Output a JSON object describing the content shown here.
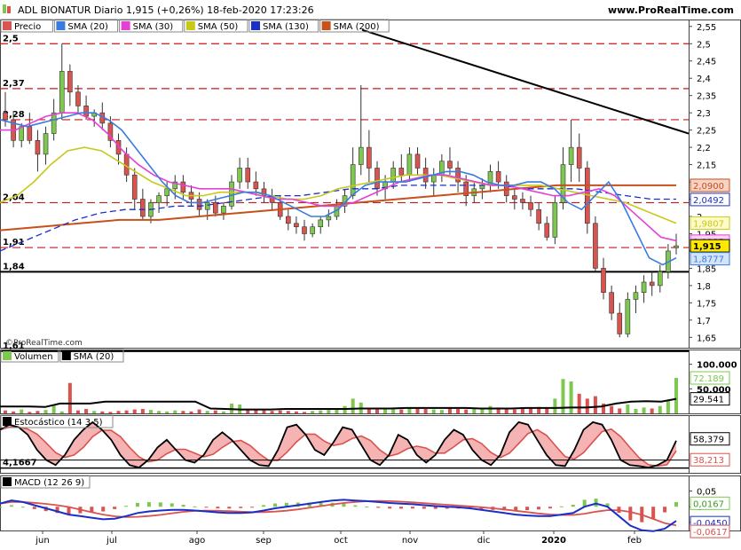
{
  "header": {
    "title": "ADL BIONATUR Diario 1,915 (+0,26%) 18-feb-2020 17:23:26",
    "website": "www.ProRealTime.com",
    "watermark": "©ProRealTime.com"
  },
  "colors": {
    "up": "#7ec850",
    "down": "#d9534f",
    "sma20": "#3a7be0",
    "sma30": "#e63fd8",
    "sma50": "#c8c81a",
    "sma130": "#1a2fc8",
    "sma200": "#c8501a",
    "support": "#c81a1a",
    "fill_up": "#f2a0a0",
    "fill_down": "#9a9aa8"
  },
  "chart_data": [
    {
      "type": "candlestick",
      "panel": "price",
      "legend": [
        {
          "label": "Precio",
          "color": "#d9534f"
        },
        {
          "label": "SMA (20)",
          "color": "#3a7be0"
        },
        {
          "label": "SMA (30)",
          "color": "#e63fd8"
        },
        {
          "label": "SMA (50)",
          "color": "#c8c81a"
        },
        {
          "label": "SMA (130)",
          "color": "#1a2fc8"
        },
        {
          "label": "SMA (200)",
          "color": "#c8501a"
        }
      ],
      "x_ticks": [
        "jun",
        "jul",
        "ago",
        "sep",
        "oct",
        "nov",
        "dic",
        "2020",
        "feb"
      ],
      "y_ticks": [
        "2,55",
        "2,5",
        "2,45",
        "2,4",
        "2,35",
        "2,3",
        "2,25",
        "2,2",
        "2,15",
        "2,1",
        "2,05",
        "2",
        "1,95",
        "1,9",
        "1,85",
        "1,8",
        "1,75",
        "1,7",
        "1,65"
      ],
      "ylim": [
        1.62,
        2.57
      ],
      "level_labels": [
        "2,5",
        "2,37",
        "2,28",
        "2,04",
        "1,91",
        "1,84",
        "1,61"
      ],
      "dashed_levels": [
        2.5,
        2.37,
        2.28,
        2.04,
        1.91
      ],
      "solid_levels": [
        1.84,
        1.61
      ],
      "trendline": {
        "from": [
          "oct",
          2.54
        ],
        "to": [
          "2020-feb end",
          2.24
        ]
      },
      "right_labels": [
        {
          "text": "2,0900",
          "value": 2.09,
          "bg": "#f6d3c4",
          "border": "#c8501a"
        },
        {
          "text": "2,0492",
          "value": 2.049,
          "bg": "#ffffff",
          "border": "#1a2fc8"
        },
        {
          "text": "1,9807",
          "value": 1.981,
          "bg": "#fdfcc8",
          "border": "#c8c81a"
        },
        {
          "text": "1,9185",
          "value": 1.9285,
          "bg": "#f8d3f4",
          "border": "#e63fd8"
        },
        {
          "text": "1,915",
          "value": 1.915,
          "bg": "#ffe800",
          "border": "#000000",
          "bold": true
        },
        {
          "text": "1,8777",
          "value": 1.8777,
          "bg": "#d3e3f8",
          "border": "#3a7be0"
        }
      ],
      "approx_series": {
        "close_open_ranges_note": "candles approximated from chart; last close 1.915",
        "candles": [
          [
            2.3,
            2.36,
            2.26,
            2.28
          ],
          [
            2.28,
            2.3,
            2.2,
            2.22
          ],
          [
            2.22,
            2.27,
            2.2,
            2.26
          ],
          [
            2.26,
            2.3,
            2.21,
            2.22
          ],
          [
            2.22,
            2.25,
            2.13,
            2.18
          ],
          [
            2.18,
            2.26,
            2.15,
            2.24
          ],
          [
            2.24,
            2.34,
            2.22,
            2.3
          ],
          [
            2.3,
            2.5,
            2.28,
            2.42
          ],
          [
            2.42,
            2.44,
            2.32,
            2.36
          ],
          [
            2.36,
            2.38,
            2.3,
            2.32
          ],
          [
            2.32,
            2.35,
            2.28,
            2.29
          ],
          [
            2.29,
            2.31,
            2.26,
            2.3
          ],
          [
            2.3,
            2.33,
            2.25,
            2.27
          ],
          [
            2.27,
            2.29,
            2.2,
            2.22
          ],
          [
            2.22,
            2.24,
            2.15,
            2.18
          ],
          [
            2.18,
            2.2,
            2.1,
            2.12
          ],
          [
            2.12,
            2.14,
            2.02,
            2.05
          ],
          [
            2.05,
            2.08,
            1.99,
            2.0
          ],
          [
            2.0,
            2.05,
            1.98,
            2.04
          ],
          [
            2.04,
            2.07,
            2.01,
            2.06
          ],
          [
            2.06,
            2.1,
            2.03,
            2.08
          ],
          [
            2.08,
            2.12,
            2.05,
            2.1
          ],
          [
            2.1,
            2.12,
            2.05,
            2.07
          ],
          [
            2.07,
            2.09,
            2.03,
            2.05
          ],
          [
            2.05,
            2.07,
            2.0,
            2.02
          ],
          [
            2.02,
            2.05,
            1.99,
            2.04
          ],
          [
            2.04,
            2.06,
            2.0,
            2.01
          ],
          [
            2.01,
            2.04,
            1.99,
            2.03
          ],
          [
            2.03,
            2.12,
            2.02,
            2.1
          ],
          [
            2.1,
            2.17,
            2.08,
            2.14
          ],
          [
            2.14,
            2.17,
            2.08,
            2.1
          ],
          [
            2.1,
            2.13,
            2.06,
            2.08
          ],
          [
            2.08,
            2.1,
            2.04,
            2.06
          ],
          [
            2.06,
            2.08,
            2.02,
            2.04
          ],
          [
            2.04,
            2.06,
            1.99,
            2.0
          ],
          [
            2.0,
            2.02,
            1.96,
            1.98
          ],
          [
            1.98,
            2.0,
            1.95,
            1.97
          ],
          [
            1.97,
            1.99,
            1.93,
            1.95
          ],
          [
            1.95,
            1.98,
            1.94,
            1.97
          ],
          [
            1.97,
            2.0,
            1.95,
            1.99
          ],
          [
            1.99,
            2.02,
            1.97,
            2.0
          ],
          [
            2.0,
            2.05,
            1.99,
            2.03
          ],
          [
            2.03,
            2.08,
            2.01,
            2.06
          ],
          [
            2.06,
            2.2,
            2.05,
            2.15
          ],
          [
            2.15,
            2.38,
            2.12,
            2.2
          ],
          [
            2.2,
            2.25,
            2.1,
            2.14
          ],
          [
            2.14,
            2.16,
            2.06,
            2.08
          ],
          [
            2.08,
            2.12,
            2.05,
            2.1
          ],
          [
            2.1,
            2.16,
            2.08,
            2.14
          ],
          [
            2.14,
            2.18,
            2.1,
            2.12
          ],
          [
            2.12,
            2.2,
            2.1,
            2.18
          ],
          [
            2.18,
            2.2,
            2.12,
            2.14
          ],
          [
            2.14,
            2.17,
            2.08,
            2.1
          ],
          [
            2.1,
            2.14,
            2.06,
            2.12
          ],
          [
            2.12,
            2.18,
            2.1,
            2.16
          ],
          [
            2.16,
            2.2,
            2.12,
            2.14
          ],
          [
            2.14,
            2.16,
            2.07,
            2.1
          ],
          [
            2.1,
            2.12,
            2.03,
            2.06
          ],
          [
            2.06,
            2.1,
            2.04,
            2.08
          ],
          [
            2.08,
            2.11,
            2.05,
            2.09
          ],
          [
            2.09,
            2.15,
            2.07,
            2.13
          ],
          [
            2.13,
            2.16,
            2.08,
            2.1
          ],
          [
            2.1,
            2.12,
            2.04,
            2.06
          ],
          [
            2.06,
            2.08,
            2.02,
            2.05
          ],
          [
            2.05,
            2.07,
            2.02,
            2.04
          ],
          [
            2.04,
            2.06,
            2.0,
            2.02
          ],
          [
            2.02,
            2.04,
            1.96,
            1.98
          ],
          [
            1.98,
            2.0,
            1.93,
            1.94
          ],
          [
            1.94,
            2.06,
            1.92,
            2.04
          ],
          [
            2.04,
            2.2,
            2.02,
            2.15
          ],
          [
            2.15,
            2.28,
            2.1,
            2.2
          ],
          [
            2.2,
            2.24,
            2.1,
            2.14
          ],
          [
            2.14,
            2.16,
            1.95,
            1.98
          ],
          [
            1.98,
            2.0,
            1.84,
            1.85
          ],
          [
            1.85,
            1.88,
            1.76,
            1.78
          ],
          [
            1.78,
            1.8,
            1.7,
            1.72
          ],
          [
            1.72,
            1.75,
            1.65,
            1.66
          ],
          [
            1.66,
            1.78,
            1.65,
            1.76
          ],
          [
            1.76,
            1.8,
            1.72,
            1.78
          ],
          [
            1.78,
            1.83,
            1.75,
            1.81
          ],
          [
            1.81,
            1.84,
            1.77,
            1.8
          ],
          [
            1.8,
            1.86,
            1.78,
            1.84
          ],
          [
            1.84,
            1.92,
            1.82,
            1.9
          ],
          [
            1.91,
            1.95,
            1.89,
            1.915
          ]
        ],
        "sma20": [
          2.28,
          2.27,
          2.26,
          2.27,
          2.28,
          2.29,
          2.3,
          2.3,
          2.28,
          2.25,
          2.2,
          2.15,
          2.1,
          2.06,
          2.04,
          2.04,
          2.05,
          2.06,
          2.07,
          2.07,
          2.06,
          2.04,
          2.02,
          2.0,
          2.0,
          2.02,
          2.06,
          2.09,
          2.1,
          2.1,
          2.1,
          2.11,
          2.12,
          2.13,
          2.13,
          2.12,
          2.1,
          2.09,
          2.09,
          2.1,
          2.1,
          2.08,
          2.04,
          2.02,
          2.06,
          2.1,
          2.04,
          1.96,
          1.88,
          1.86,
          1.88
        ],
        "sma30": [
          2.25,
          2.25,
          2.27,
          2.29,
          2.3,
          2.3,
          2.28,
          2.24,
          2.19,
          2.15,
          2.12,
          2.1,
          2.09,
          2.08,
          2.08,
          2.08,
          2.07,
          2.06,
          2.05,
          2.05,
          2.04,
          2.03,
          2.03,
          2.04,
          2.06,
          2.08,
          2.1,
          2.11,
          2.12,
          2.12,
          2.11,
          2.1,
          2.09,
          2.09,
          2.08,
          2.07,
          2.06,
          2.06,
          2.07,
          2.08,
          2.06,
          2.02,
          1.98,
          1.94,
          1.93
        ],
        "sma50": [
          2.04,
          2.06,
          2.1,
          2.15,
          2.19,
          2.2,
          2.19,
          2.16,
          2.13,
          2.1,
          2.08,
          2.06,
          2.06,
          2.07,
          2.07,
          2.07,
          2.06,
          2.05,
          2.05,
          2.06,
          2.08,
          2.09,
          2.1,
          2.11,
          2.12,
          2.12,
          2.12,
          2.11,
          2.1,
          2.09,
          2.09,
          2.09,
          2.09,
          2.08,
          2.07,
          2.06,
          2.05,
          2.04,
          2.02,
          2.0,
          1.98
        ],
        "sma130": [
          1.9,
          1.93,
          1.96,
          1.99,
          2.01,
          2.02,
          2.02,
          2.03,
          2.03,
          2.04,
          2.05,
          2.06,
          2.06,
          2.07,
          2.08,
          2.08,
          2.09,
          2.09,
          2.09,
          2.09,
          2.09,
          2.08,
          2.08,
          2.08,
          2.07,
          2.06,
          2.05,
          2.05
        ],
        "sma200": [
          1.96,
          1.97,
          1.98,
          1.99,
          1.99,
          2.0,
          2.01,
          2.02,
          2.03,
          2.04,
          2.05,
          2.06,
          2.07,
          2.08,
          2.09,
          2.09,
          2.09,
          2.09
        ]
      }
    },
    {
      "type": "bar",
      "panel": "volume",
      "legend": [
        {
          "label": "Volumen",
          "color": "#7ec850"
        },
        {
          "label": "SMA (20)",
          "color": "#000000"
        }
      ],
      "y_ticks": [
        "100.000",
        "50.000"
      ],
      "right_labels": [
        {
          "text": "72.189",
          "bg": "#ffffff",
          "border": "#7ec850",
          "color": "#7ec850"
        },
        {
          "text": "29.541",
          "bg": "#ffffff",
          "border": "#000000",
          "color": "#000000"
        }
      ]
    },
    {
      "type": "line",
      "panel": "stochastic",
      "legend": [
        {
          "label": "Estocástico (14 3 5)",
          "color": "#000000"
        }
      ],
      "level_label": "4,1667",
      "right_labels": [
        {
          "text": "58,379",
          "bg": "#ffffff",
          "border": "#000000",
          "color": "#000000"
        },
        {
          "text": "38,213",
          "bg": "#ffffff",
          "border": "#d9534f",
          "color": "#d9534f"
        }
      ]
    },
    {
      "type": "bar",
      "panel": "macd",
      "legend": [
        {
          "label": "MACD (12 26 9)",
          "color": "#000000"
        }
      ],
      "y_ticks": [
        "0,05",
        "0",
        "-0,05"
      ],
      "right_labels": [
        {
          "text": "0,0167",
          "bg": "#ffffff",
          "border": "#7ec850",
          "color": "#3a9a20"
        },
        {
          "text": "-0,0450",
          "bg": "#ffffff",
          "border": "#1a2fc8",
          "color": "#1a2fc8"
        },
        {
          "text": "-0,0617",
          "bg": "#ffffff",
          "border": "#d9534f",
          "color": "#d9534f"
        }
      ]
    }
  ]
}
